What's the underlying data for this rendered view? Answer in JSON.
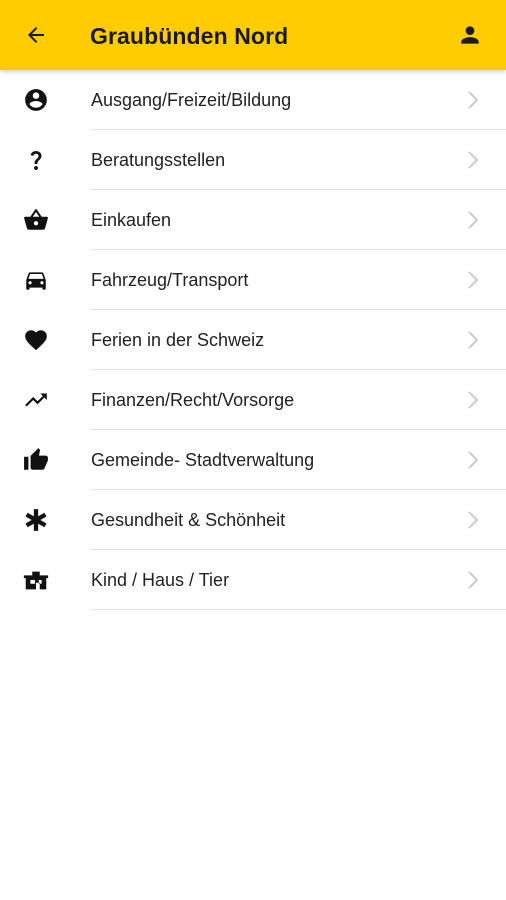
{
  "colors": {
    "appbar_background": "#ffcc00",
    "text": "#1a1a1a",
    "chevron": "#c4c4c4",
    "divider": "#e2e2e2"
  },
  "header": {
    "title": "Graubünden Nord",
    "back_icon": "arrow-left-icon",
    "profile_icon": "person-icon"
  },
  "categories": [
    {
      "label": "Ausgang/Freizeit/Bildung",
      "icon": "account-circle-icon"
    },
    {
      "label": "Beratungsstellen",
      "icon": "question-mark-icon"
    },
    {
      "label": "Einkaufen",
      "icon": "shopping-basket-icon"
    },
    {
      "label": "Fahrzeug/Transport",
      "icon": "car-icon"
    },
    {
      "label": "Ferien in der Schweiz",
      "icon": "heart-icon"
    },
    {
      "label": "Finanzen/Recht/Vorsorge",
      "icon": "trending-up-icon"
    },
    {
      "label": "Gemeinde- Stadtverwaltung",
      "icon": "thumb-up-icon"
    },
    {
      "label": "Gesundheit & Schönheit",
      "icon": "asterisk-icon"
    },
    {
      "label": "Kind / Haus / Tier",
      "icon": "house-icon"
    }
  ]
}
